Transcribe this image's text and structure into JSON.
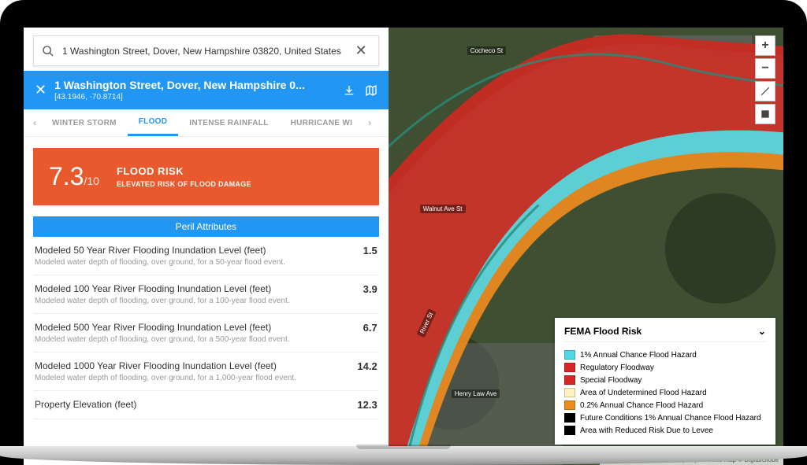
{
  "search": {
    "value": "1 Washington Street, Dover, New Hampshire 03820, United States"
  },
  "address": {
    "title": "1 Washington Street, Dover, New Hampshire 0...",
    "coords": "[43.1946, -70.8714]"
  },
  "tabs": {
    "t0": "WINTER STORM",
    "t1": "FLOOD",
    "t2": "INTENSE RAINFALL",
    "t3": "HURRICANE WI"
  },
  "risk": {
    "score": "7.3",
    "of": "/10",
    "title": "FLOOD RISK",
    "sub": "ELEVATED RISK OF FLOOD DAMAGE"
  },
  "peril_header": "Peril Attributes",
  "attrs": {
    "a0": {
      "label": "Modeled 50 Year River Flooding Inundation Level (feet)",
      "desc": "Modeled water depth of flooding, over ground, for a 50-year flood event.",
      "val": "1.5"
    },
    "a1": {
      "label": "Modeled 100 Year River Flooding Inundation Level (feet)",
      "desc": "Modeled water depth of flooding, over ground, for a 100-year flood event.",
      "val": "3.9"
    },
    "a2": {
      "label": "Modeled 500 Year River Flooding Inundation Level (feet)",
      "desc": "Modeled water depth of flooding, over ground, for a 500-year flood event.",
      "val": "6.7"
    },
    "a3": {
      "label": "Modeled 1000 Year River Flooding Inundation Level (feet)",
      "desc": "Modeled water depth of flooding, over ground, for a 1,000-year flood event.",
      "val": "14.2"
    },
    "a4": {
      "label": "Property Elevation (feet)",
      "desc": "",
      "val": "12.3"
    }
  },
  "roads": {
    "r0": "Cocheco St",
    "r1": "Walnut Ave St",
    "r2": "River St",
    "r3": "Henry Law Ave"
  },
  "legend": {
    "title": "FEMA Flood Risk",
    "i0": {
      "c": "#4fd6e8",
      "t": "1% Annual Chance Flood Hazard"
    },
    "i1": {
      "c": "#d62728",
      "t": "Regulatory Floodway"
    },
    "i2": {
      "c": "#d62728",
      "t": "Special Floodway"
    },
    "i3": {
      "c": "#fef3c0",
      "t": "Area of Undetermined Flood Hazard"
    },
    "i4": {
      "c": "#ed8b1f",
      "t": "0.2% Annual Chance Flood Hazard"
    },
    "i5": {
      "c": "#000000",
      "t": "Future Conditions 1% Annual Chance Flood Hazard"
    },
    "i6": {
      "c": "#000000",
      "t": "Area with Reduced Risk Due to Levee"
    }
  },
  "attribution": "© Mapbox © OpenStreetMap Improve this map © DigitalGlobe"
}
